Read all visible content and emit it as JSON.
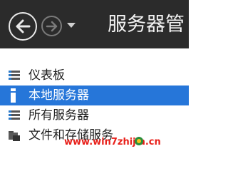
{
  "header": {
    "title": "服务器管",
    "back_icon": "back-arrow-icon",
    "forward_icon": "forward-arrow-icon",
    "history_icon": "chevron-down-icon"
  },
  "sidebar": {
    "items": [
      {
        "label": "仪表板",
        "icon": "dashboard-icon",
        "selected": false
      },
      {
        "label": "本地服务器",
        "icon": "local-server-icon",
        "selected": true
      },
      {
        "label": "所有服务器",
        "icon": "all-servers-icon",
        "selected": false
      },
      {
        "label": "文件和存储服务",
        "icon": "folder-icon",
        "selected": false
      }
    ]
  },
  "watermark": {
    "text": "www.win7zhijia.cn"
  },
  "colors": {
    "header_bg": "#2b2b2b",
    "selected_bg": "#2676d9",
    "watermark": "#e8201a"
  }
}
